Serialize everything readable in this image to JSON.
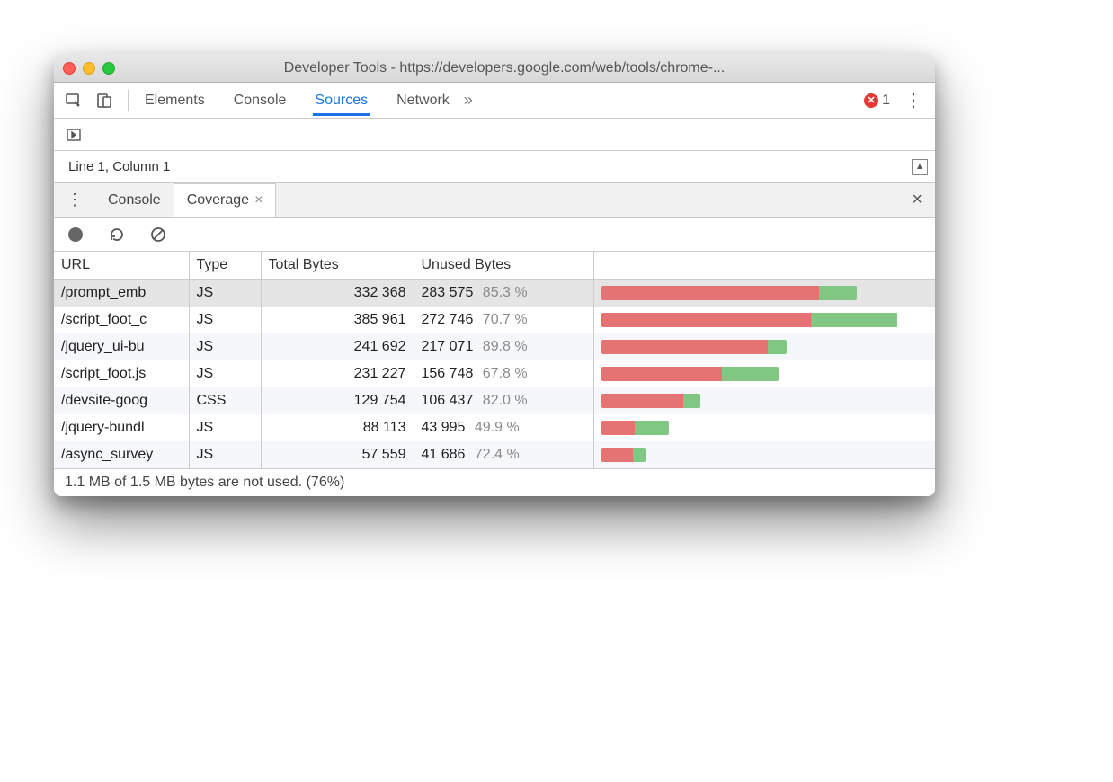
{
  "window": {
    "title": "Developer Tools - https://developers.google.com/web/tools/chrome-..."
  },
  "toolbar": {
    "tabs": [
      "Elements",
      "Console",
      "Sources",
      "Network"
    ],
    "active_tab": "Sources",
    "more_glyph": "»",
    "error_count": "1"
  },
  "status": {
    "line_col": "Line 1, Column 1"
  },
  "drawer": {
    "tabs": [
      "Console",
      "Coverage"
    ],
    "active_tab": "Coverage"
  },
  "coverage": {
    "columns": [
      "URL",
      "Type",
      "Total Bytes",
      "Unused Bytes",
      ""
    ],
    "max_total_bytes": 385961,
    "rows": [
      {
        "url": "/prompt_emb",
        "type": "JS",
        "total_fmt": "332 368",
        "unused_fmt": "283 575",
        "pct": "85.3 %",
        "total": 332368,
        "unused": 283575,
        "selected": true
      },
      {
        "url": "/script_foot_c",
        "type": "JS",
        "total_fmt": "385 961",
        "unused_fmt": "272 746",
        "pct": "70.7 %",
        "total": 385961,
        "unused": 272746
      },
      {
        "url": "/jquery_ui-bu",
        "type": "JS",
        "total_fmt": "241 692",
        "unused_fmt": "217 071",
        "pct": "89.8 %",
        "total": 241692,
        "unused": 217071
      },
      {
        "url": "/script_foot.js",
        "type": "JS",
        "total_fmt": "231 227",
        "unused_fmt": "156 748",
        "pct": "67.8 %",
        "total": 231227,
        "unused": 156748
      },
      {
        "url": "/devsite-goog",
        "type": "CSS",
        "total_fmt": "129 754",
        "unused_fmt": "106 437",
        "pct": "82.0 %",
        "total": 129754,
        "unused": 106437
      },
      {
        "url": "/jquery-bundl",
        "type": "JS",
        "total_fmt": "88 113",
        "unused_fmt": "43 995",
        "pct": "49.9 %",
        "total": 88113,
        "unused": 43995
      },
      {
        "url": "/async_survey",
        "type": "JS",
        "total_fmt": "57 559",
        "unused_fmt": "41 686",
        "pct": "72.4 %",
        "total": 57559,
        "unused": 41686
      }
    ]
  },
  "footer": {
    "summary": "1.1 MB of 1.5 MB bytes are not used. (76%)"
  }
}
